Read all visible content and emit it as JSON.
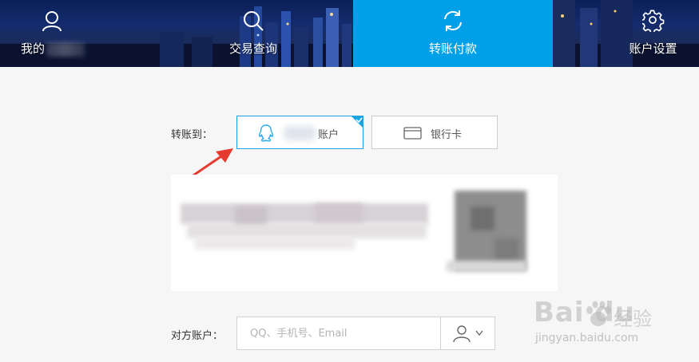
{
  "nav": {
    "items": [
      {
        "label": "我的",
        "icon": "user-icon"
      },
      {
        "label": "交易查询",
        "icon": "search-icon"
      },
      {
        "label": "转账付款",
        "icon": "refresh-icon"
      },
      {
        "label": "账户设置",
        "icon": "gear-icon"
      }
    ],
    "active_index": 2
  },
  "transfer": {
    "label": "转账到：",
    "options": [
      {
        "label": "账户",
        "icon": "qq-icon",
        "selected": true
      },
      {
        "label": "银行卡",
        "icon": "bank-card-icon",
        "selected": false
      }
    ]
  },
  "account": {
    "label": "对方账户：",
    "placeholder": "QQ、手机号、Email",
    "value": ""
  },
  "watermark": {
    "logo": "Bai du",
    "cn": "经验",
    "url": "jingyan.baidu.com"
  },
  "colors": {
    "accent": "#00a0e9",
    "selected_border": "#1aa3e1",
    "annotation_arrow": "#e53a2f"
  }
}
